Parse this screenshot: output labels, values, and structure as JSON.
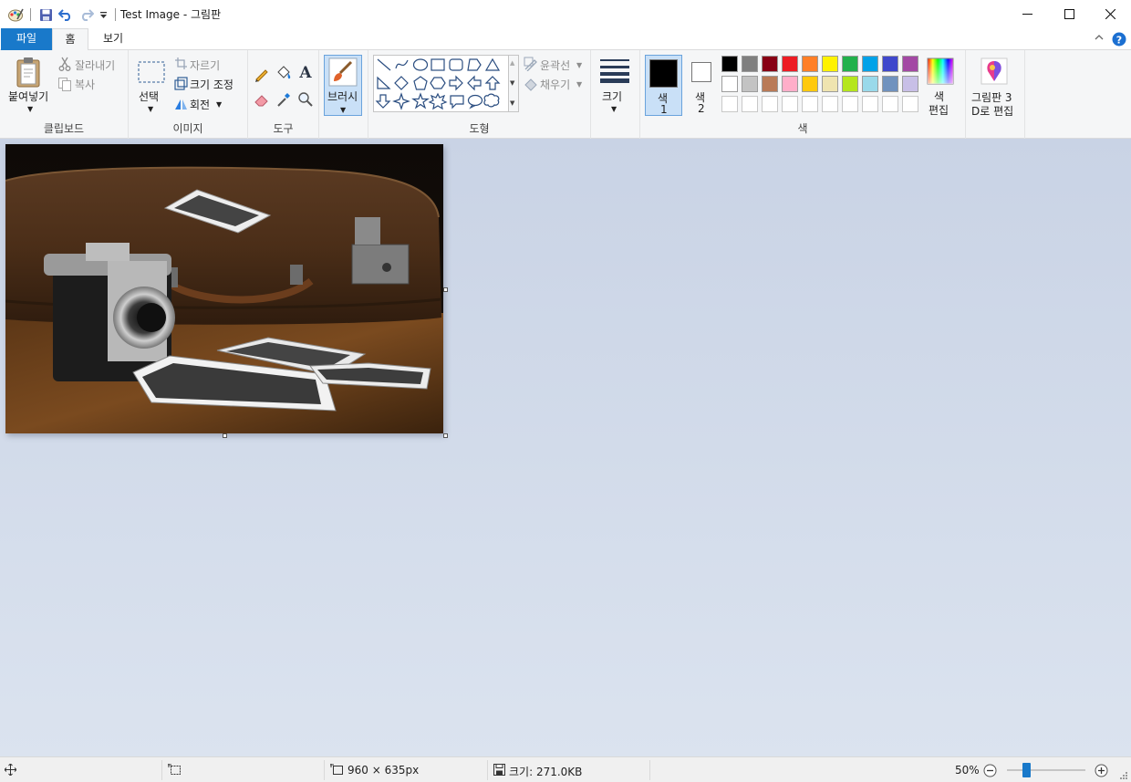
{
  "window": {
    "title": "Test Image - 그림판"
  },
  "tabs": {
    "file": "파일",
    "home": "홈",
    "view": "보기"
  },
  "clipboard": {
    "paste": "붙여넣기",
    "cut": "잘라내기",
    "copy": "복사",
    "label": "클립보드"
  },
  "image": {
    "select": "선택",
    "crop": "자르기",
    "resize": "크기 조정",
    "rotate": "회전",
    "label": "이미지"
  },
  "tools": {
    "label": "도구"
  },
  "brushes": {
    "label": "브러시"
  },
  "shapes": {
    "outline": "윤곽선",
    "fill": "채우기",
    "label": "도형"
  },
  "size": {
    "label": "크기"
  },
  "colors": {
    "color1": "색",
    "color1_num": "1",
    "color2": "색",
    "color2_num": "2",
    "edit_line1": "색",
    "edit_line2": "편집",
    "label": "색",
    "color1_value": "#000000",
    "color2_value": "#ffffff",
    "palette_row1": [
      "#000000",
      "#7f7f7f",
      "#880015",
      "#ed1c24",
      "#ff7f27",
      "#fff200",
      "#22b14c",
      "#00a2e8",
      "#3f48cc",
      "#a349a4"
    ],
    "palette_row2": [
      "#ffffff",
      "#c3c3c3",
      "#b97a57",
      "#ffaec9",
      "#ffc90e",
      "#efe4b0",
      "#b5e61d",
      "#99d9ea",
      "#7092be",
      "#c8bfe7"
    ]
  },
  "paint3d": {
    "line1": "그림판 3",
    "line2": "D로 편집"
  },
  "status": {
    "dimensions": "960 × 635px",
    "filesize": "크기: 271.0KB",
    "zoom": "50%"
  },
  "zoom_level_fraction": 0.25
}
